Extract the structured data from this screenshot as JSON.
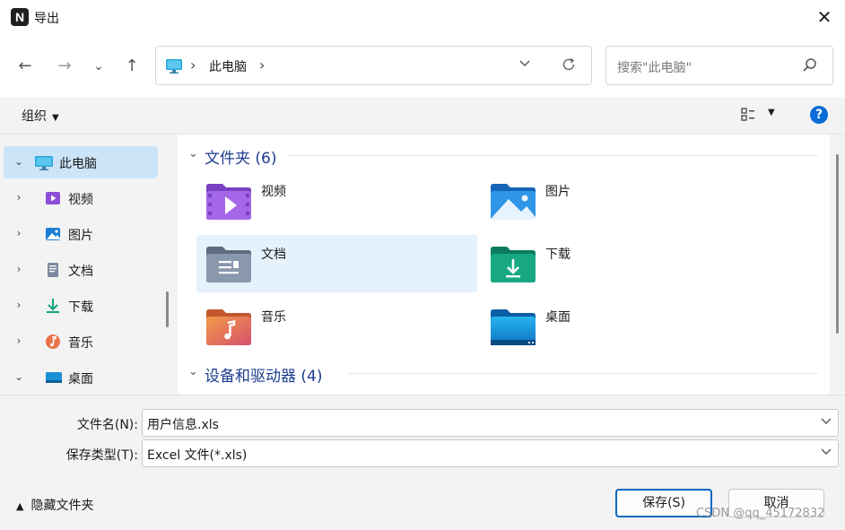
{
  "window": {
    "app_logo": "N",
    "title": "导出",
    "close_glyph": "✕"
  },
  "nav": {
    "back_glyph": "←",
    "forward_glyph": "→",
    "recent_glyph": "⌄",
    "up_glyph": "↑",
    "address": {
      "separator": "›",
      "location": "此电脑"
    },
    "search_placeholder": "搜索\"此电脑\""
  },
  "toolbar": {
    "organize": "组织"
  },
  "sidebar": {
    "items": [
      {
        "label": "此电脑",
        "icon": "computer-icon",
        "expanded": true,
        "selected": true
      },
      {
        "label": "视频",
        "icon": "video-icon"
      },
      {
        "label": "图片",
        "icon": "pictures-icon"
      },
      {
        "label": "文档",
        "icon": "documents-icon"
      },
      {
        "label": "下载",
        "icon": "download-icon"
      },
      {
        "label": "音乐",
        "icon": "music-icon"
      },
      {
        "label": "桌面",
        "icon": "desktop-icon",
        "expanded": true
      }
    ]
  },
  "main": {
    "groups": [
      {
        "title": "文件夹 (6)"
      },
      {
        "title": "设备和驱动器 (4)"
      }
    ],
    "folders": [
      {
        "label": "视频",
        "icon": "video-folder-icon"
      },
      {
        "label": "图片",
        "icon": "pictures-folder-icon"
      },
      {
        "label": "文档",
        "icon": "documents-folder-icon",
        "selected": true
      },
      {
        "label": "下载",
        "icon": "download-folder-icon"
      },
      {
        "label": "音乐",
        "icon": "music-folder-icon"
      },
      {
        "label": "桌面",
        "icon": "desktop-folder-icon"
      }
    ]
  },
  "form": {
    "filename_label": "文件名(N):",
    "filename_value": "用户信息.xls",
    "filetype_label": "保存类型(T):",
    "filetype_value": "Excel 文件(*.xls)"
  },
  "footer": {
    "hide_folders": "隐藏文件夹",
    "save": "保存(S)",
    "cancel": "取消",
    "watermark": "CSDN @qq_45172832"
  },
  "colors": {
    "accent": "#0067c0",
    "selection": "#cce4f7",
    "group_title": "#1e3d8f"
  }
}
